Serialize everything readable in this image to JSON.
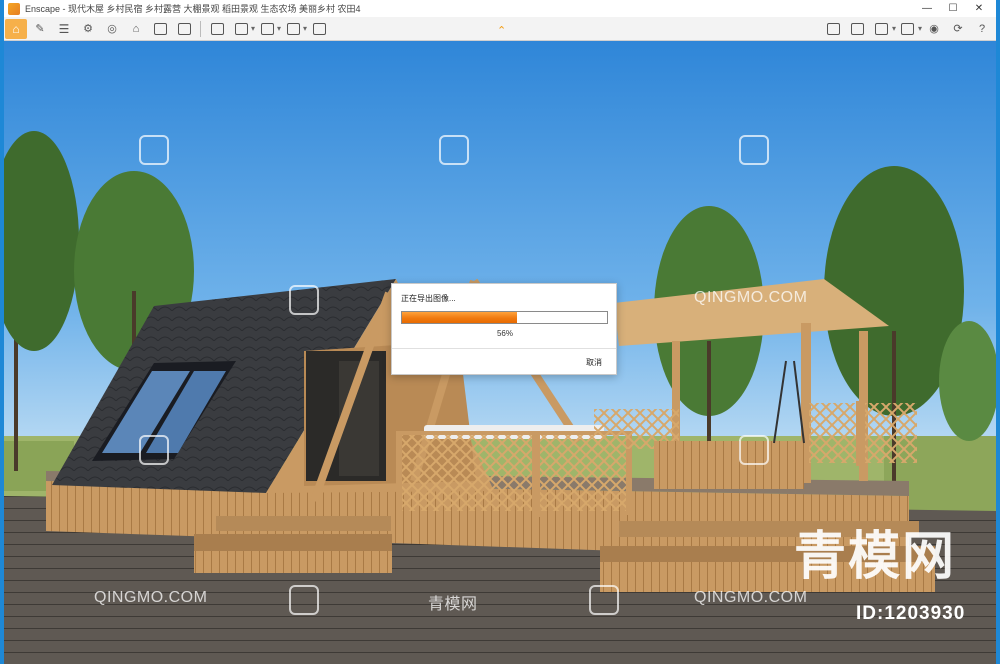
{
  "titlebar": {
    "title": "Enscape - 现代木屋 乡村民宿 乡村露营 大棚景观 稻田景观 生态农场 美丽乡村 农田4",
    "minimize_glyph": "—",
    "maximize_glyph": "☐",
    "close_glyph": "✕"
  },
  "toolbar": {
    "left_icons": [
      "home-icon",
      "brush-icon",
      "list-icon",
      "settings-icon",
      "bounce-icon",
      "house-icon",
      "building-icon",
      "screenshot-icon",
      "export-icon",
      "panorama-icon",
      "batch-render-icon",
      "video-icon",
      "walkthrough-icon"
    ],
    "right_icons": [
      "asset-library-icon",
      "camera-icon",
      "cube-icon",
      "layers-icon",
      "view-icon",
      "sync-icon",
      "help-icon"
    ],
    "collapse_glyph": "⌃"
  },
  "export_dialog": {
    "title": "正在导出图像...",
    "progress": 0.56,
    "percent_label": "56%",
    "cancel_label": "取消"
  },
  "watermarks": {
    "brand_text": "青模网",
    "site_text": "QINGMO.COM",
    "id_text": "ID:1203930"
  },
  "colors": {
    "accent": "#f39c12",
    "window_border": "#1e88d6",
    "progress_fill": "#f07a10"
  }
}
